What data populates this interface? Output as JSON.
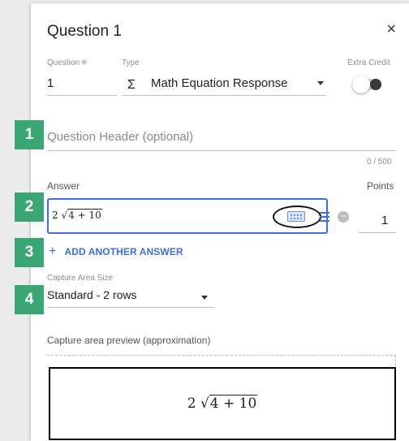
{
  "dialog": {
    "title": "Question 1",
    "close_glyph": "×"
  },
  "question_number": {
    "label": "Question #",
    "value": "1"
  },
  "type": {
    "label": "Type",
    "icon_glyph": "Σ",
    "value": "Math Equation Response"
  },
  "extra_credit": {
    "label": "Extra Credit",
    "enabled": false
  },
  "header": {
    "placeholder": "Question Header (optional)",
    "counter": "0 / 500"
  },
  "answer": {
    "label": "Answer",
    "points_label": "Points",
    "coefficient": "2",
    "radicand": "4 + 10",
    "points_value": "1",
    "add_another_label": "ADD ANOTHER ANSWER"
  },
  "capture_area": {
    "label": "Capture Area Size",
    "value": "Standard - 2 rows"
  },
  "preview": {
    "label": "Capture area preview (approximation)",
    "coefficient": "2",
    "radicand": "4 + 10"
  },
  "steps": [
    "1",
    "2",
    "3",
    "4"
  ],
  "colors": {
    "step_badge": "#3aa673",
    "accent_blue": "#3b6fe3"
  }
}
